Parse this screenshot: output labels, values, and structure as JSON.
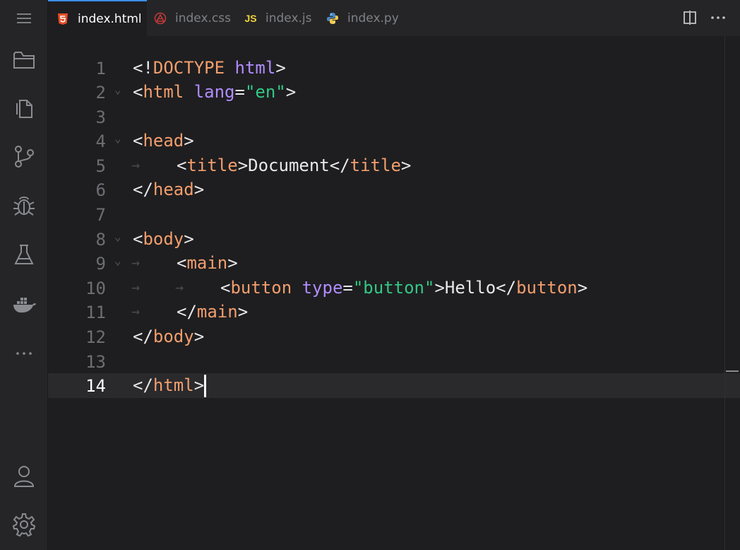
{
  "tabs": [
    {
      "label": "index.html",
      "icon": "html5-icon",
      "active": true
    },
    {
      "label": "index.css",
      "icon": "css-icon",
      "active": false
    },
    {
      "label": "index.js",
      "icon": "js-icon",
      "active": false
    },
    {
      "label": "index.py",
      "icon": "python-icon",
      "active": false
    }
  ],
  "tab_icons": {
    "js_text": "JS"
  },
  "activity_bar": {
    "top_items": [
      "menu-icon",
      "explorer-icon",
      "files-icon",
      "source-control-icon",
      "debug-icon",
      "testing-icon",
      "docker-icon",
      "more-icon"
    ],
    "bottom_items": [
      "account-icon",
      "settings-icon"
    ]
  },
  "toolbar": {
    "split_editor_icon": "split-editor-icon",
    "more_actions_icon": "more-actions-icon"
  },
  "editor": {
    "current_line": 14,
    "line_numbers": [
      "1",
      "2",
      "3",
      "4",
      "5",
      "6",
      "7",
      "8",
      "9",
      "10",
      "11",
      "12",
      "13",
      "14"
    ],
    "lines": {
      "l1": {
        "open": "<!",
        "doctype": "DOCTYPE",
        "space": " ",
        "attr": "html",
        "close": ">"
      },
      "l2": {
        "open": "<",
        "tag": "html",
        "space": " ",
        "attr": "lang",
        "eq": "=",
        "str": "\"en\"",
        "close": ">"
      },
      "l4": {
        "open": "<",
        "tag": "head",
        "close": ">"
      },
      "l5": {
        "open": "<",
        "tag": "title",
        "close": ">",
        "text": "Document",
        "open2": "</",
        "tag2": "title",
        "close2": ">"
      },
      "l6": {
        "open": "</",
        "tag": "head",
        "close": ">"
      },
      "l8": {
        "open": "<",
        "tag": "body",
        "close": ">"
      },
      "l9": {
        "open": "<",
        "tag": "main",
        "close": ">"
      },
      "l10": {
        "open": "<",
        "tag": "button",
        "space": " ",
        "attr": "type",
        "eq": "=",
        "str": "\"button\"",
        "close": ">",
        "text": "Hello",
        "open2": "</",
        "tag2": "button",
        "close2": ">"
      },
      "l11": {
        "open": "</",
        "tag": "main",
        "close": ">"
      },
      "l12": {
        "open": "</",
        "tag": "body",
        "close": ">"
      },
      "l14": {
        "open": "</",
        "tag": "html",
        "close": ">"
      }
    },
    "indent_guide_glyph": "→",
    "fold_glyph": "⌄"
  },
  "colors": {
    "tag": "#f29e6d",
    "attribute": "#b18cff",
    "string": "#33c785",
    "punctuation": "#e8e8ea",
    "active_tab_border": "#3b8eea",
    "html5_icon": "#e44d26",
    "css_icon": "#c33a3a",
    "js_icon": "#f0d43a"
  }
}
